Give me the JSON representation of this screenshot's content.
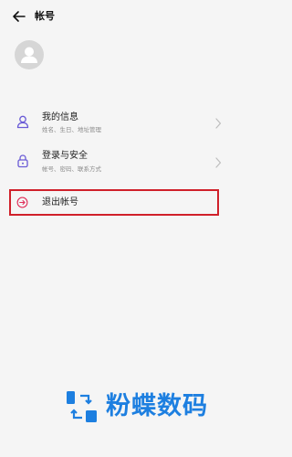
{
  "header": {
    "title": "帐号"
  },
  "menu": [
    {
      "title": "我的信息",
      "subtitle": "姓名、生日、地址管理",
      "icon": "person-icon"
    },
    {
      "title": "登录与安全",
      "subtitle": "帐号、密码、联系方式",
      "icon": "lock-icon"
    }
  ],
  "logout": {
    "label": "退出帐号",
    "icon": "arrow-circle-icon"
  },
  "colors": {
    "accent": "#6a5bd6",
    "logout_icon": "#e0305a",
    "highlight_box": "#d0202a",
    "watermark": "#1d7fe0"
  },
  "watermark": {
    "text": "粉蝶数码"
  }
}
